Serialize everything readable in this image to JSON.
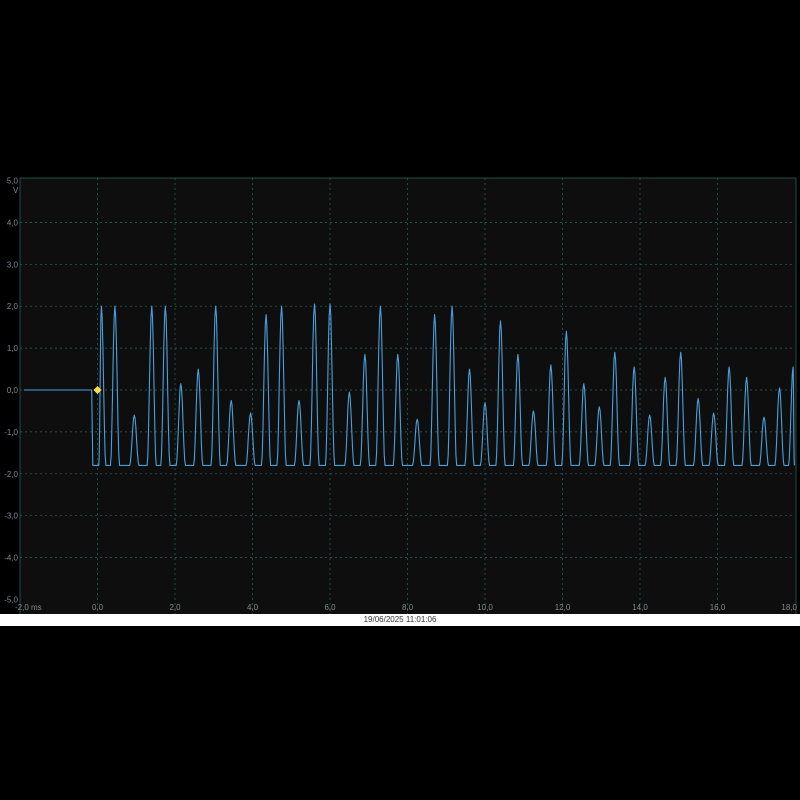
{
  "chart_data": {
    "type": "line",
    "x_unit": "ms",
    "y_unit": "V",
    "xlim": [
      -2.0,
      18.0
    ],
    "ylim": [
      -5.0,
      5.0
    ],
    "x_ticks": [
      "-2,0 ms",
      "0,0",
      "2,0",
      "4,0",
      "6,0",
      "8,0",
      "10,0",
      "12,0",
      "14,0",
      "16,0",
      "18,0"
    ],
    "y_ticks": [
      "5,0",
      "4,0",
      "3,0",
      "2,0",
      "1,0",
      "0,0",
      "-1,0",
      "-2,0",
      "-3,0",
      "-4,0",
      "-5,0"
    ],
    "grid": true,
    "colors": {
      "trace": "#4aa0dc",
      "trigger": "#ffe04a",
      "grid": "#2c6a66"
    },
    "trigger": {
      "x": 0.0,
      "y": 0.0
    },
    "baseline_low": -1.8,
    "series": [
      {
        "peaks": [
          [
            0.1,
            2.0
          ],
          [
            0.45,
            2.0
          ],
          [
            0.95,
            -0.6
          ],
          [
            1.4,
            2.0
          ],
          [
            1.75,
            2.0
          ],
          [
            2.15,
            0.15
          ],
          [
            2.6,
            0.5
          ],
          [
            3.05,
            2.0
          ],
          [
            3.45,
            -0.25
          ],
          [
            3.95,
            -0.55
          ],
          [
            4.35,
            1.8
          ],
          [
            4.75,
            2.0
          ],
          [
            5.2,
            -0.25
          ],
          [
            5.6,
            2.05
          ],
          [
            6.0,
            2.05
          ],
          [
            6.5,
            -0.05
          ],
          [
            6.9,
            0.85
          ],
          [
            7.3,
            2.0
          ],
          [
            7.75,
            0.85
          ],
          [
            8.25,
            -0.7
          ],
          [
            8.7,
            1.8
          ],
          [
            9.15,
            2.0
          ],
          [
            9.6,
            0.5
          ],
          [
            10.0,
            -0.3
          ],
          [
            10.4,
            1.65
          ],
          [
            10.85,
            0.85
          ],
          [
            11.25,
            -0.5
          ],
          [
            11.7,
            0.6
          ],
          [
            12.1,
            1.4
          ],
          [
            12.55,
            0.15
          ],
          [
            12.95,
            -0.4
          ],
          [
            13.35,
            0.9
          ],
          [
            13.85,
            0.55
          ],
          [
            14.25,
            -0.6
          ],
          [
            14.65,
            0.3
          ],
          [
            15.05,
            0.9
          ],
          [
            15.5,
            -0.2
          ],
          [
            15.9,
            -0.55
          ],
          [
            16.3,
            0.55
          ],
          [
            16.75,
            0.3
          ],
          [
            17.2,
            -0.65
          ],
          [
            17.6,
            0.05
          ],
          [
            17.95,
            0.55
          ]
        ]
      }
    ]
  },
  "footer": {
    "timestamp": "19/06/2025 11:01:06"
  }
}
